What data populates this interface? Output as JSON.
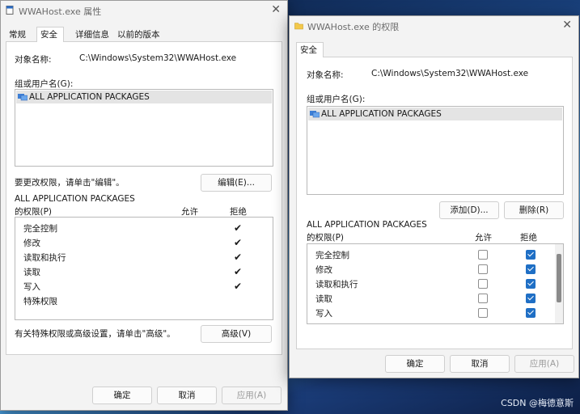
{
  "left_window": {
    "title": "WWAHost.exe 属性",
    "tabs": [
      "常规",
      "安全",
      "详细信息",
      "以前的版本"
    ],
    "object_label": "对象名称:",
    "object_path": "C:\\Windows\\System32\\WWAHost.exe",
    "group_label": "组或用户名(G):",
    "group_items": [
      "ALL APPLICATION PACKAGES"
    ],
    "change_text": "要更改权限，请单击\"编辑\"。",
    "edit_button": "编辑(E)...",
    "perm_title_1": "ALL APPLICATION PACKAGES",
    "perm_title_2": "的权限(P)",
    "allow_header": "允许",
    "deny_header": "拒绝",
    "permissions": [
      {
        "name": "完全控制",
        "deny": true
      },
      {
        "name": "修改",
        "deny": true
      },
      {
        "name": "读取和执行",
        "deny": true
      },
      {
        "name": "读取",
        "deny": true
      },
      {
        "name": "写入",
        "deny": true
      },
      {
        "name": "特殊权限",
        "deny": false
      }
    ],
    "advanced_text": "有关特殊权限或高级设置，请单击\"高级\"。",
    "advanced_button": "高级(V)",
    "ok": "确定",
    "cancel": "取消",
    "apply": "应用(A)"
  },
  "right_window": {
    "title": "WWAHost.exe 的权限",
    "tab": "安全",
    "object_label": "对象名称:",
    "object_path": "C:\\Windows\\System32\\WWAHost.exe",
    "group_label": "组或用户名(G):",
    "group_items": [
      "ALL APPLICATION PACKAGES"
    ],
    "add_button": "添加(D)...",
    "remove_button": "删除(R)",
    "perm_title_1": "ALL APPLICATION PACKAGES",
    "perm_title_2": "的权限(P)",
    "allow_header": "允许",
    "deny_header": "拒绝",
    "permissions": [
      {
        "name": "完全控制",
        "allow": false,
        "deny": true
      },
      {
        "name": "修改",
        "allow": false,
        "deny": true
      },
      {
        "name": "读取和执行",
        "allow": false,
        "deny": true
      },
      {
        "name": "读取",
        "allow": false,
        "deny": true
      },
      {
        "name": "写入",
        "allow": false,
        "deny": true
      }
    ],
    "ok": "确定",
    "cancel": "取消",
    "apply": "应用(A)"
  },
  "watermark": "CSDN @梅德意斯",
  "colors": {
    "checkbox_on": "#1f6fc5",
    "window_bg": "#f3f3f3"
  }
}
